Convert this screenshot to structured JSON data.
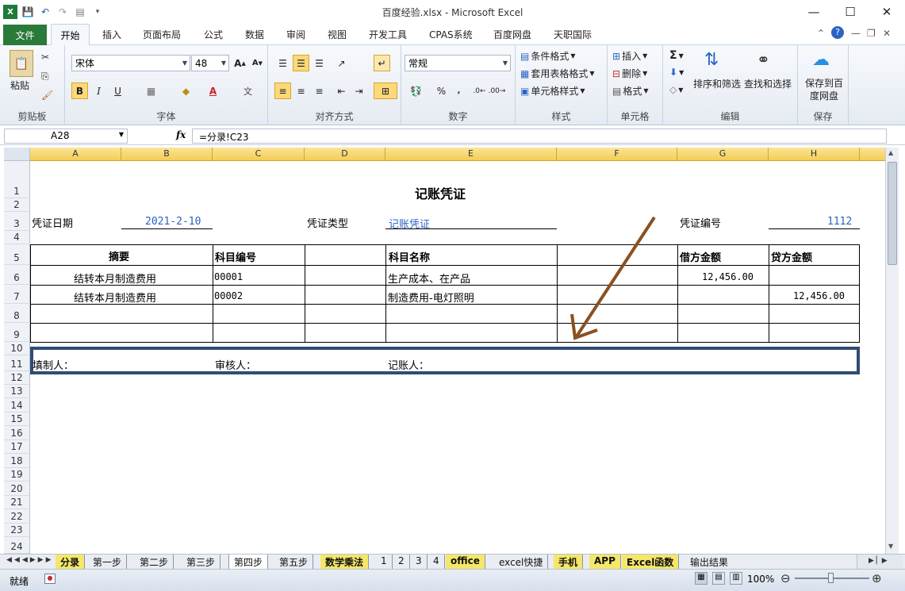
{
  "window": {
    "title": "百度经验.xlsx - Microsoft Excel"
  },
  "tabs": {
    "file": "文件",
    "items": [
      "开始",
      "插入",
      "页面布局",
      "公式",
      "数据",
      "审阅",
      "视图",
      "开发工具",
      "CPAS系统",
      "百度网盘",
      "天职国际"
    ]
  },
  "ribbon": {
    "clipboard": {
      "label": "剪贴板",
      "paste": "粘贴"
    },
    "font": {
      "label": "字体",
      "name": "宋体",
      "size": "48",
      "bold": "B",
      "italic": "I",
      "underline": "U"
    },
    "alignment": {
      "label": "对齐方式"
    },
    "number": {
      "label": "数字",
      "format": "常规",
      "percent": "%"
    },
    "styles": {
      "label": "样式",
      "conditional": "条件格式",
      "table": "套用表格格式",
      "cell": "单元格样式"
    },
    "cells": {
      "label": "单元格",
      "insert": "插入",
      "delete": "删除",
      "format": "格式"
    },
    "editing": {
      "label": "编辑",
      "sort": "排序和筛选",
      "find": "查找和选择"
    },
    "save": {
      "label": "保存",
      "button": "保存到百度网盘"
    }
  },
  "formula_bar": {
    "namebox": "A28",
    "fx": "fx",
    "formula": "=分录!C23"
  },
  "columns": [
    "A",
    "B",
    "C",
    "D",
    "E",
    "F",
    "G",
    "H"
  ],
  "rows": [
    "1",
    "2",
    "3",
    "4",
    "5",
    "6",
    "7",
    "8",
    "9",
    "10",
    "11",
    "12",
    "13",
    "14",
    "15",
    "16",
    "17",
    "18",
    "19",
    "20",
    "21",
    "22",
    "23",
    "24"
  ],
  "voucher": {
    "title": "记账凭证",
    "date_label": "凭证日期",
    "date_value": "2021-2-10",
    "type_label": "凭证类型",
    "type_value": "记账凭证",
    "no_label": "凭证编号",
    "no_value": "1112",
    "headers": {
      "summary": "摘要",
      "code": "科目编号",
      "name": "科目名称",
      "debit": "借方金额",
      "credit": "贷方金额"
    },
    "lines": [
      {
        "summary": "结转本月制造费用",
        "code": "00001",
        "name": "生产成本、在产品",
        "debit": "12,456.00",
        "credit": ""
      },
      {
        "summary": "结转本月制造费用",
        "code": "00002",
        "name": "制造费用-电灯照明",
        "debit": "",
        "credit": "12,456.00"
      }
    ],
    "footer": {
      "maker": "填制人：",
      "reviewer": "审核人：",
      "bookkeeper": "记账人："
    }
  },
  "sheet_tabs": [
    "分录",
    "第一步",
    "第二步",
    "第三步",
    "第四步",
    "第五步",
    "数学乘法",
    "1",
    "2",
    "3",
    "4",
    "office",
    "excel快捷",
    "手机",
    "APP",
    "Excel函数",
    "输出结果"
  ],
  "active_sheet": "第四步",
  "status": {
    "ready": "就绪",
    "zoom": "100%"
  },
  "colors": {
    "accent_green": "#2a7a3a",
    "header_gold": "#f5cd53",
    "blue_text": "#2962c2",
    "highlight_border": "#2f4c74",
    "arrow": "#8b5020"
  }
}
